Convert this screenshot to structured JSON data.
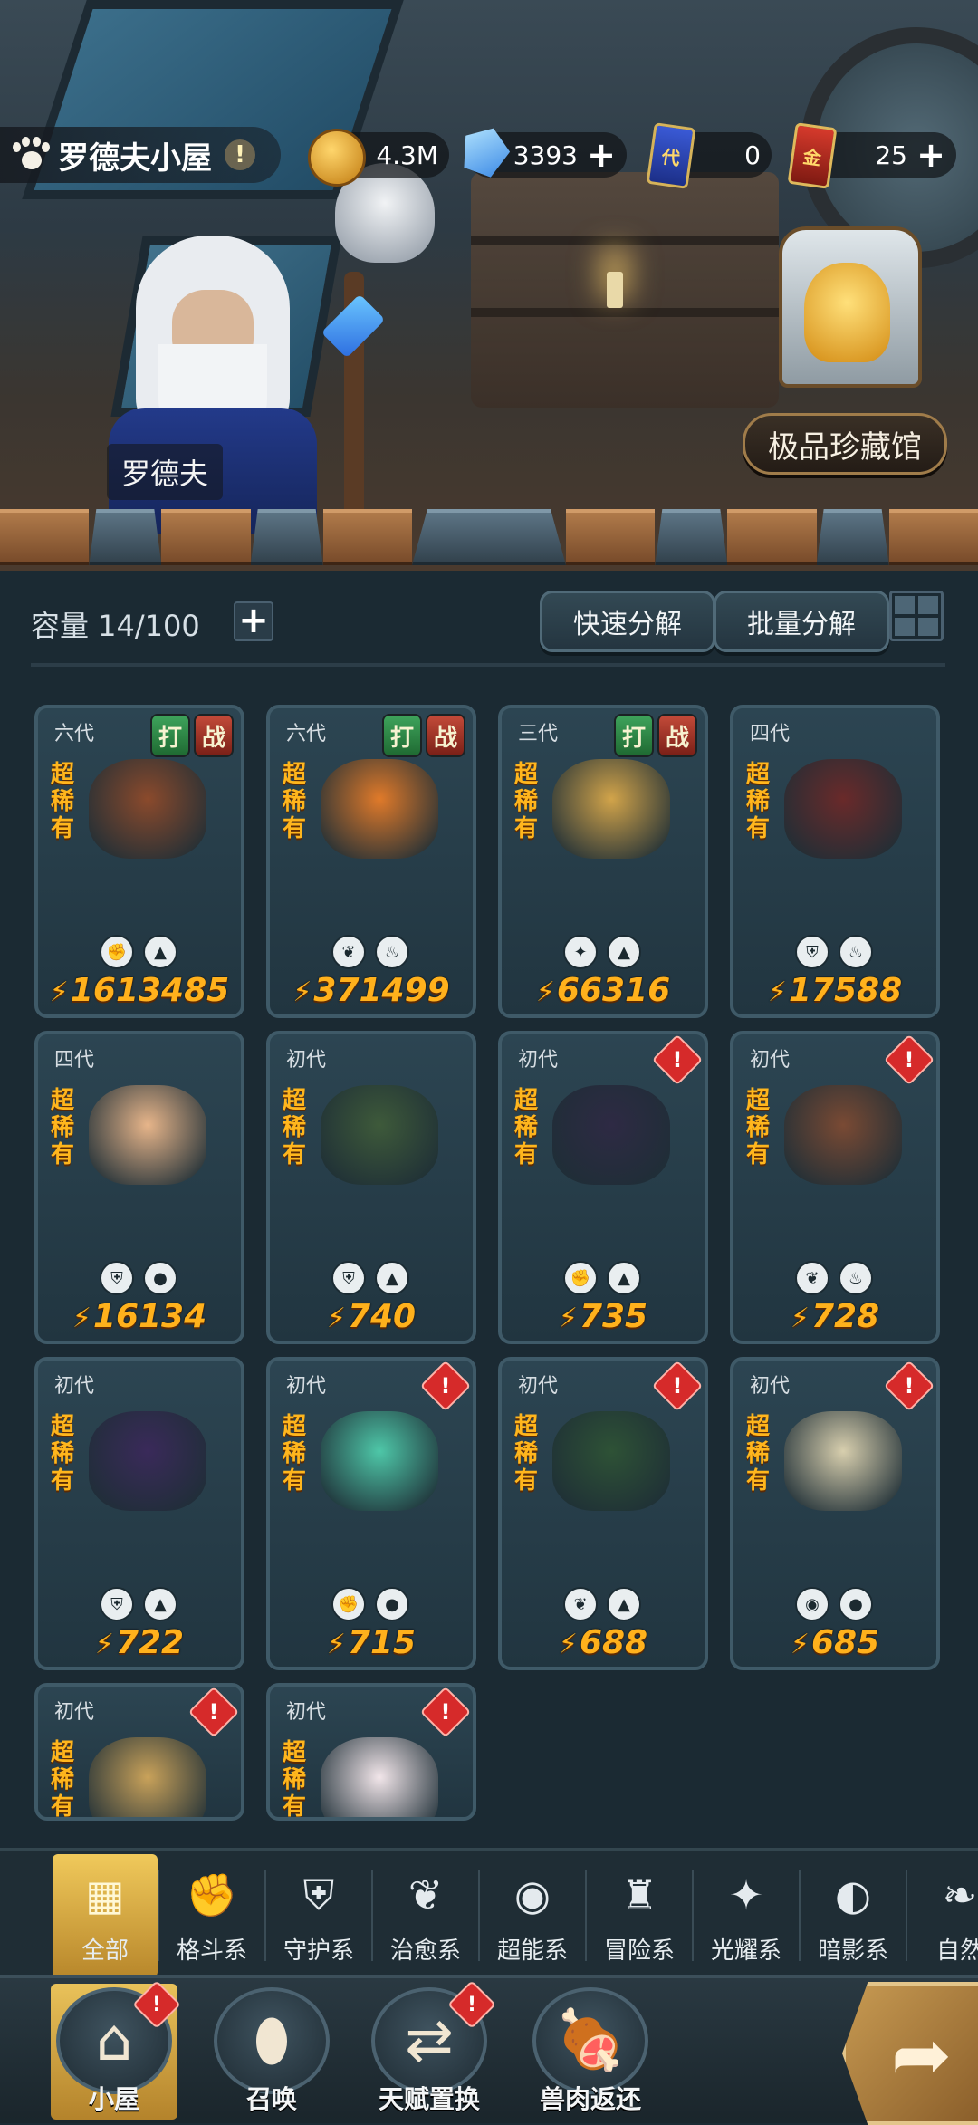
{
  "header": {
    "location_name": "罗德夫小屋",
    "npc_name": "罗德夫",
    "collection_label": "极品珍藏馆"
  },
  "resources": [
    {
      "icon": "gold-coin-icon",
      "value": "4.3M"
    },
    {
      "icon": "diamond-icon",
      "value": "3393"
    },
    {
      "icon": "blue-ticket-icon",
      "glyph": "代",
      "value": "0"
    },
    {
      "icon": "red-ticket-icon",
      "glyph": "金",
      "value": "25"
    }
  ],
  "toolbar": {
    "capacity": "容量 14/100",
    "quick_decompose": "快速分解",
    "batch_decompose": "批量分解"
  },
  "badges": {
    "hit": "打",
    "war": "战",
    "alert": "!"
  },
  "rarity_label": "超稀有",
  "cards": [
    {
      "gen": "六代",
      "power": "1613485",
      "badges": true,
      "alert": false,
      "elements": [
        "fist-icon",
        "mountain-icon"
      ],
      "color": "#8b4a2c"
    },
    {
      "gen": "六代",
      "power": "371499",
      "badges": true,
      "alert": false,
      "elements": [
        "leaf-icon",
        "fire-icon"
      ],
      "color": "#e07a2a"
    },
    {
      "gen": "三代",
      "power": "66316",
      "badges": true,
      "alert": false,
      "elements": [
        "shine-icon",
        "mountain-icon"
      ],
      "color": "#d2a44a"
    },
    {
      "gen": "四代",
      "power": "17588",
      "badges": false,
      "alert": false,
      "elements": [
        "shield-icon",
        "fire-icon"
      ],
      "color": "#6a2a2a"
    },
    {
      "gen": "四代",
      "power": "16134",
      "badges": false,
      "alert": false,
      "elements": [
        "shield-icon",
        "water-icon"
      ],
      "color": "#e7b58a"
    },
    {
      "gen": "初代",
      "power": "740",
      "badges": false,
      "alert": false,
      "elements": [
        "shield-icon",
        "mountain-icon"
      ],
      "color": "#3e5a3a"
    },
    {
      "gen": "初代",
      "power": "735",
      "badges": false,
      "alert": true,
      "elements": [
        "fist-icon",
        "mountain-icon"
      ],
      "color": "#2e2a44"
    },
    {
      "gen": "初代",
      "power": "728",
      "badges": false,
      "alert": true,
      "elements": [
        "leaf-icon",
        "fire-icon"
      ],
      "color": "#7a4a34"
    },
    {
      "gen": "初代",
      "power": "722",
      "badges": false,
      "alert": false,
      "elements": [
        "shield-icon",
        "mountain-icon"
      ],
      "color": "#3a2a5a"
    },
    {
      "gen": "初代",
      "power": "715",
      "badges": false,
      "alert": true,
      "elements": [
        "fist-icon",
        "water-icon"
      ],
      "color": "#4ec7a8"
    },
    {
      "gen": "初代",
      "power": "688",
      "badges": false,
      "alert": true,
      "elements": [
        "leaf-icon",
        "mountain-icon"
      ],
      "color": "#2e5236"
    },
    {
      "gen": "初代",
      "power": "685",
      "badges": false,
      "alert": true,
      "elements": [
        "psychic-icon",
        "water-icon"
      ],
      "color": "#d8cfae"
    },
    {
      "gen": "初代",
      "power": "",
      "badges": false,
      "alert": true,
      "elements": [],
      "color": "#c9a25a"
    },
    {
      "gen": "初代",
      "power": "",
      "badges": false,
      "alert": true,
      "elements": [],
      "color": "#f2e6ea"
    }
  ],
  "tabs": [
    {
      "icon": "all-icon",
      "label": "全部",
      "active": true
    },
    {
      "icon": "fist-icon",
      "label": "格斗系"
    },
    {
      "icon": "shield-icon",
      "label": "守护系"
    },
    {
      "icon": "leaf-icon",
      "label": "治愈系"
    },
    {
      "icon": "psychic-icon",
      "label": "超能系"
    },
    {
      "icon": "adventure-icon",
      "label": "冒险系"
    },
    {
      "icon": "shine-icon",
      "label": "光耀系"
    },
    {
      "icon": "shadow-icon",
      "label": "暗影系"
    },
    {
      "icon": "nature-icon",
      "label": "自然"
    }
  ],
  "nav": [
    {
      "icon": "hut-icon",
      "label": "小屋",
      "active": true,
      "alert": true
    },
    {
      "icon": "egg-icon",
      "label": "召唤",
      "alert": false
    },
    {
      "icon": "swap-icon",
      "label": "天赋置换",
      "alert": true
    },
    {
      "icon": "meat-icon",
      "label": "兽肉返还",
      "alert": false
    }
  ]
}
